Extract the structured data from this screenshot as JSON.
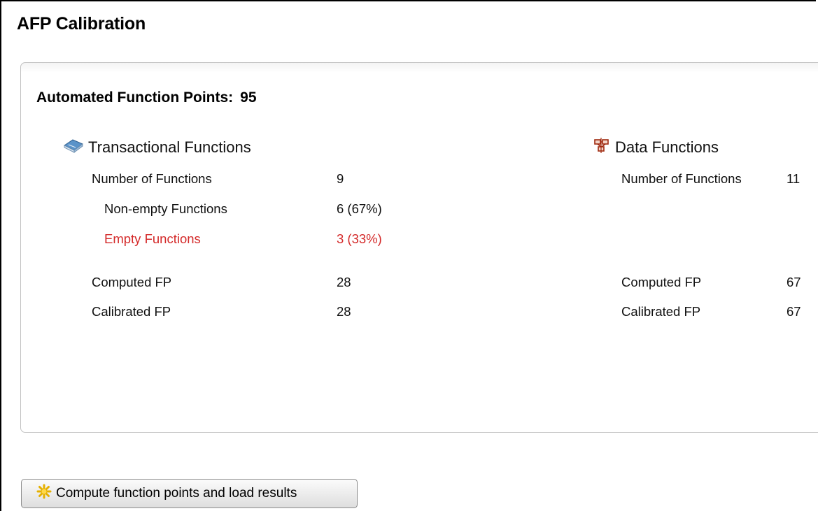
{
  "page": {
    "title": "AFP Calibration"
  },
  "summary": {
    "label": "Automated Function Points:",
    "value": "95"
  },
  "transactional": {
    "title": "Transactional Functions",
    "icon": "book-icon",
    "rows": {
      "num_functions": {
        "label": "Number of Functions",
        "value": "9"
      },
      "non_empty": {
        "label": "Non-empty Functions",
        "value": "6 (67%)"
      },
      "empty": {
        "label": "Empty Functions",
        "value": "3 (33%)"
      },
      "computed": {
        "label": "Computed FP",
        "value": "28"
      },
      "calibrated": {
        "label": "Calibrated FP",
        "value": "28"
      }
    }
  },
  "data_functions": {
    "title": "Data Functions",
    "icon": "data-structure-icon",
    "rows": {
      "num_functions": {
        "label": "Number of Functions",
        "value": "11"
      },
      "computed": {
        "label": "Computed FP",
        "value": "67"
      },
      "calibrated": {
        "label": "Calibrated FP",
        "value": "67"
      }
    }
  },
  "actions": {
    "compute_button": {
      "label": "Compute function points and load results",
      "icon": "gear-icon"
    }
  },
  "colors": {
    "empty_functions": "#d42a2a",
    "panel_border": "#c2c2c2"
  }
}
